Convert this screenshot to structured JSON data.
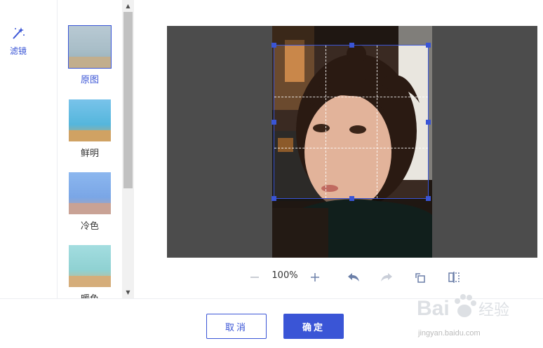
{
  "tools": {
    "filter_label": "滤镜"
  },
  "filters": [
    {
      "label": "原图"
    },
    {
      "label": "鲜明"
    },
    {
      "label": "冷色"
    },
    {
      "label": "暖色"
    }
  ],
  "toolbar": {
    "zoom": "100%"
  },
  "buttons": {
    "cancel": "取消",
    "ok": "确定"
  },
  "watermark": {
    "brand": "Bai 经验",
    "url": "jingyan.baidu.com"
  },
  "colors": {
    "accent": "#3a55d6",
    "canvas_bg": "#4c4c4c"
  }
}
